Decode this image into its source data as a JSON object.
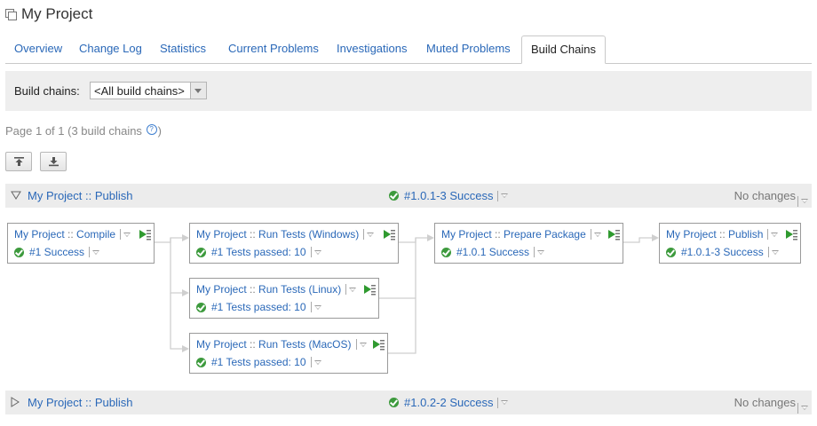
{
  "title": "My Project",
  "tabs": [
    "Overview",
    "Change Log",
    "Statistics",
    "Current Problems",
    "Investigations",
    "Muted Problems",
    "Build Chains"
  ],
  "active_tab": "Build Chains",
  "filter": {
    "label": "Build chains:",
    "selected": "<All build chains>"
  },
  "paging": {
    "text": "Page 1 of 1 (3 build chains",
    "close": ")"
  },
  "help_icon": "?",
  "toolbar": {
    "collapse_all": "collapse-all-icon",
    "expand_all": "expand-all-icon"
  },
  "chains": [
    {
      "name": "My Project :: Publish",
      "status": "#1.0.1-3 Success",
      "changes": "No changes",
      "expanded": true
    },
    {
      "name": "My Project :: Publish",
      "status": "#1.0.2-2 Success",
      "changes": "No changes",
      "expanded": false
    }
  ],
  "nodes": [
    {
      "project": "My Project",
      "sep": "::",
      "config": "Compile",
      "status": "#1 Success"
    },
    {
      "project": "My Project",
      "sep": "::",
      "config": "Run Tests (Windows)",
      "status": "#1 Tests passed: 10"
    },
    {
      "project": "My Project",
      "sep": "::",
      "config": "Run Tests (Linux)",
      "status": "#1 Tests passed: 10"
    },
    {
      "project": "My Project",
      "sep": "::",
      "config": "Run Tests (MacOS)",
      "status": "#1 Tests passed: 10"
    },
    {
      "project": "My Project",
      "sep": "::",
      "config": "Prepare Package",
      "status": "#1.0.1 Success"
    },
    {
      "project": "My Project",
      "sep": "::",
      "config": "Publish",
      "status": "#1.0.1-3 Success"
    }
  ],
  "colors": {
    "link": "#2a68b8",
    "success": "#3d9a3d",
    "run": "#2f9a2f",
    "header_bg": "#ececec"
  }
}
